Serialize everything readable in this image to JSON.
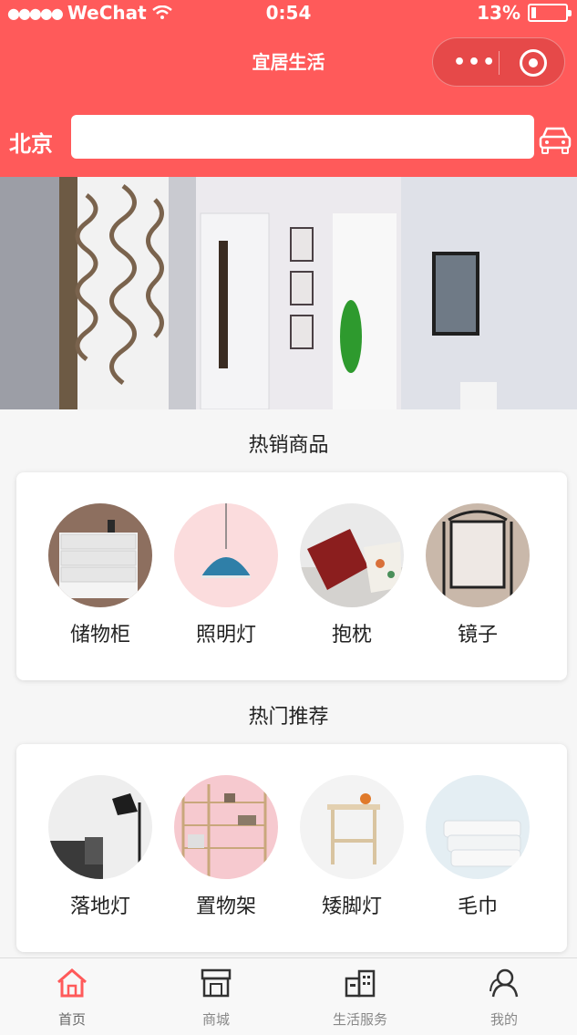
{
  "status_bar": {
    "carrier": "WeChat",
    "time": "0:54",
    "battery": "13%"
  },
  "nav": {
    "title": "宜居生活"
  },
  "search": {
    "city": "北京",
    "value": ""
  },
  "sections": [
    {
      "title": "热销商品",
      "items": [
        {
          "label": "储物柜"
        },
        {
          "label": "照明灯"
        },
        {
          "label": "抱枕"
        },
        {
          "label": "镜子"
        }
      ]
    },
    {
      "title": "热门推荐",
      "items": [
        {
          "label": "落地灯"
        },
        {
          "label": "置物架"
        },
        {
          "label": "矮脚灯"
        },
        {
          "label": "毛巾"
        }
      ]
    }
  ],
  "tabbar": {
    "tabs": [
      {
        "label": "首页"
      },
      {
        "label": "商城"
      },
      {
        "label": "生活服务"
      },
      {
        "label": "我的"
      }
    ]
  },
  "colors": {
    "primary": "#ff5a5a",
    "active_icon": "#ff5a5a"
  }
}
